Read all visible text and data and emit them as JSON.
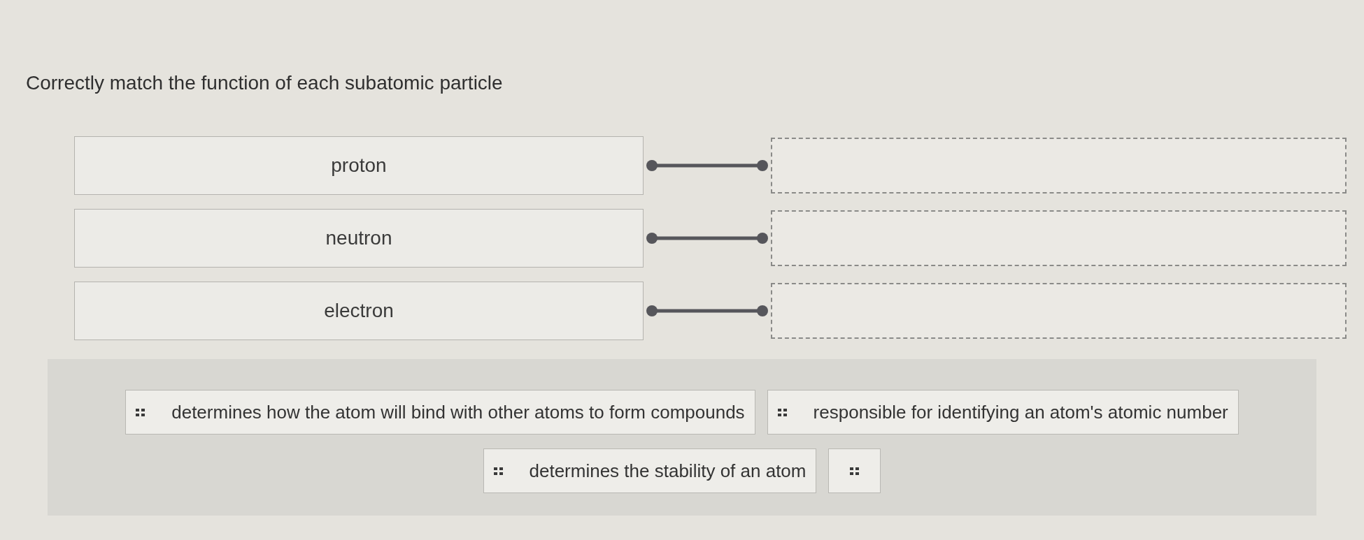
{
  "question": {
    "prompt": "Correctly match the function of each subatomic particle"
  },
  "pairs": [
    {
      "term": "proton"
    },
    {
      "term": "neutron"
    },
    {
      "term": "electron"
    }
  ],
  "answers": [
    {
      "kind": "text",
      "label": "determines how the atom will bind with other atoms to form compounds"
    },
    {
      "kind": "text",
      "label": "responsible for identifying an atom's atomic number"
    },
    {
      "kind": "text",
      "label": "determines the stability of an atom"
    },
    {
      "kind": "blank"
    }
  ]
}
